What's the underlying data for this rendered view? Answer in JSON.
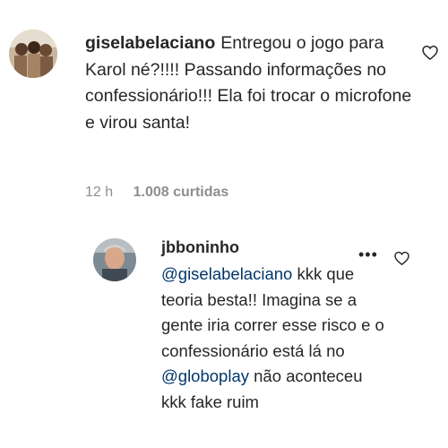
{
  "comment1": {
    "username": "giselabelaciano",
    "text": "Entregou o jogo para Karol né?!!!! Passando informações no confessionário!!! Ela foi trocar o microfone e virou santa!",
    "time": "12 h",
    "likes": "1.008 curtidas"
  },
  "reply": {
    "username": "jbboninho",
    "mention1": "@giselabelaciano",
    "text1": " kkk que teoria besta!! Imagina se a gente iria correr esse risco e o confessionário está lá no ",
    "mention2": "@globoplay",
    "text2": " não aconteceu kkk fake ruim",
    "more": "•••"
  },
  "icons": {
    "like": "heart-icon",
    "options": "more-options-icon"
  }
}
